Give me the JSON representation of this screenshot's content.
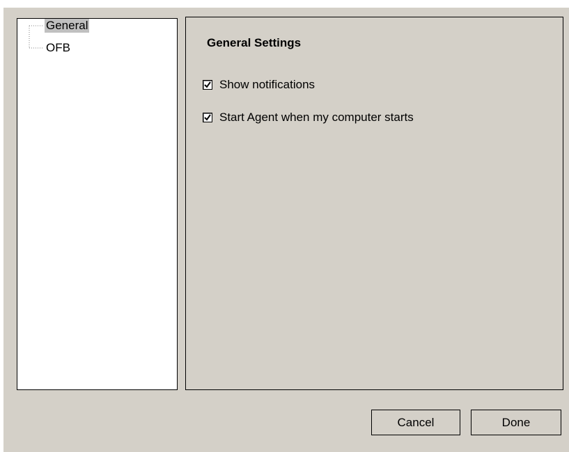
{
  "tree": {
    "items": [
      {
        "label": "General",
        "selected": true
      },
      {
        "label": "OFB",
        "selected": false
      }
    ]
  },
  "settings": {
    "title": "General Settings",
    "options": [
      {
        "label": "Show notifications",
        "checked": true
      },
      {
        "label": "Start Agent when my computer starts",
        "checked": true
      }
    ]
  },
  "buttons": {
    "cancel_label": "Cancel",
    "done_label": "Done"
  },
  "colors": {
    "window_bg": "#d4d0c8",
    "selection_bg": "#c0c0c0"
  }
}
